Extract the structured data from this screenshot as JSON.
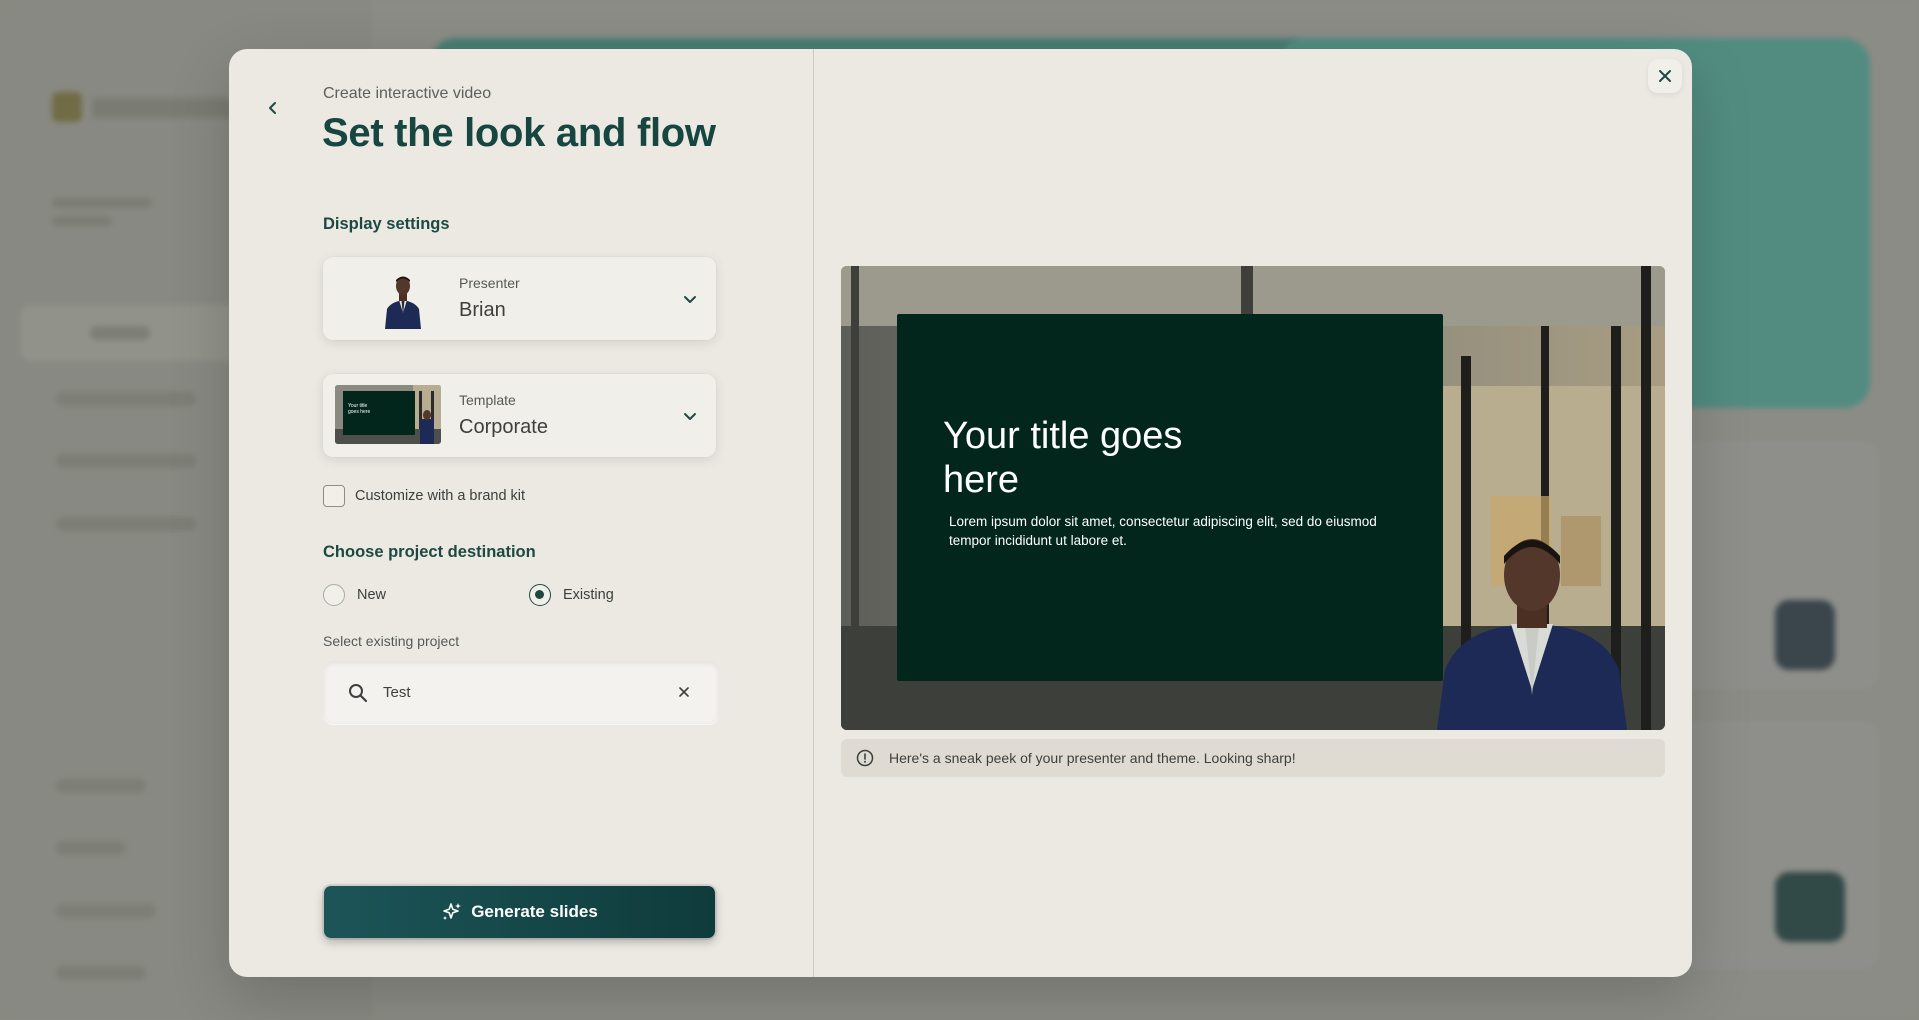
{
  "modal": {
    "eyebrow": "Create interactive video",
    "title": "Set the look and flow",
    "back_icon": "chevron-left-icon",
    "close_icon": "close-icon"
  },
  "display_settings": {
    "heading": "Display settings",
    "presenter": {
      "label": "Presenter",
      "value": "Brian"
    },
    "template": {
      "label": "Template",
      "value": "Corporate",
      "thumb_title": "Your title goes here"
    },
    "brand_kit_label": "Customize with a brand kit",
    "brand_kit_checked": false
  },
  "destination": {
    "heading": "Choose project destination",
    "options": [
      {
        "label": "New",
        "checked": false
      },
      {
        "label": "Existing",
        "checked": true
      }
    ],
    "select_label": "Select existing project",
    "search_value": "Test"
  },
  "actions": {
    "generate_label": "Generate slides",
    "generate_icon": "sparkles-icon"
  },
  "preview": {
    "slide_title": "Your title goes here",
    "slide_body": "Lorem ipsum dolor sit amet, consectetur adipiscing elit, sed do eiusmod tempor incididunt ut labore et.",
    "info_text": "Here's a sneak peek of your presenter and theme. Looking sharp!"
  },
  "colors": {
    "primary": "#17453f",
    "button": "#0f3b3b",
    "slide_bg": "#03261c",
    "modal_bg": "#ece9e3"
  }
}
